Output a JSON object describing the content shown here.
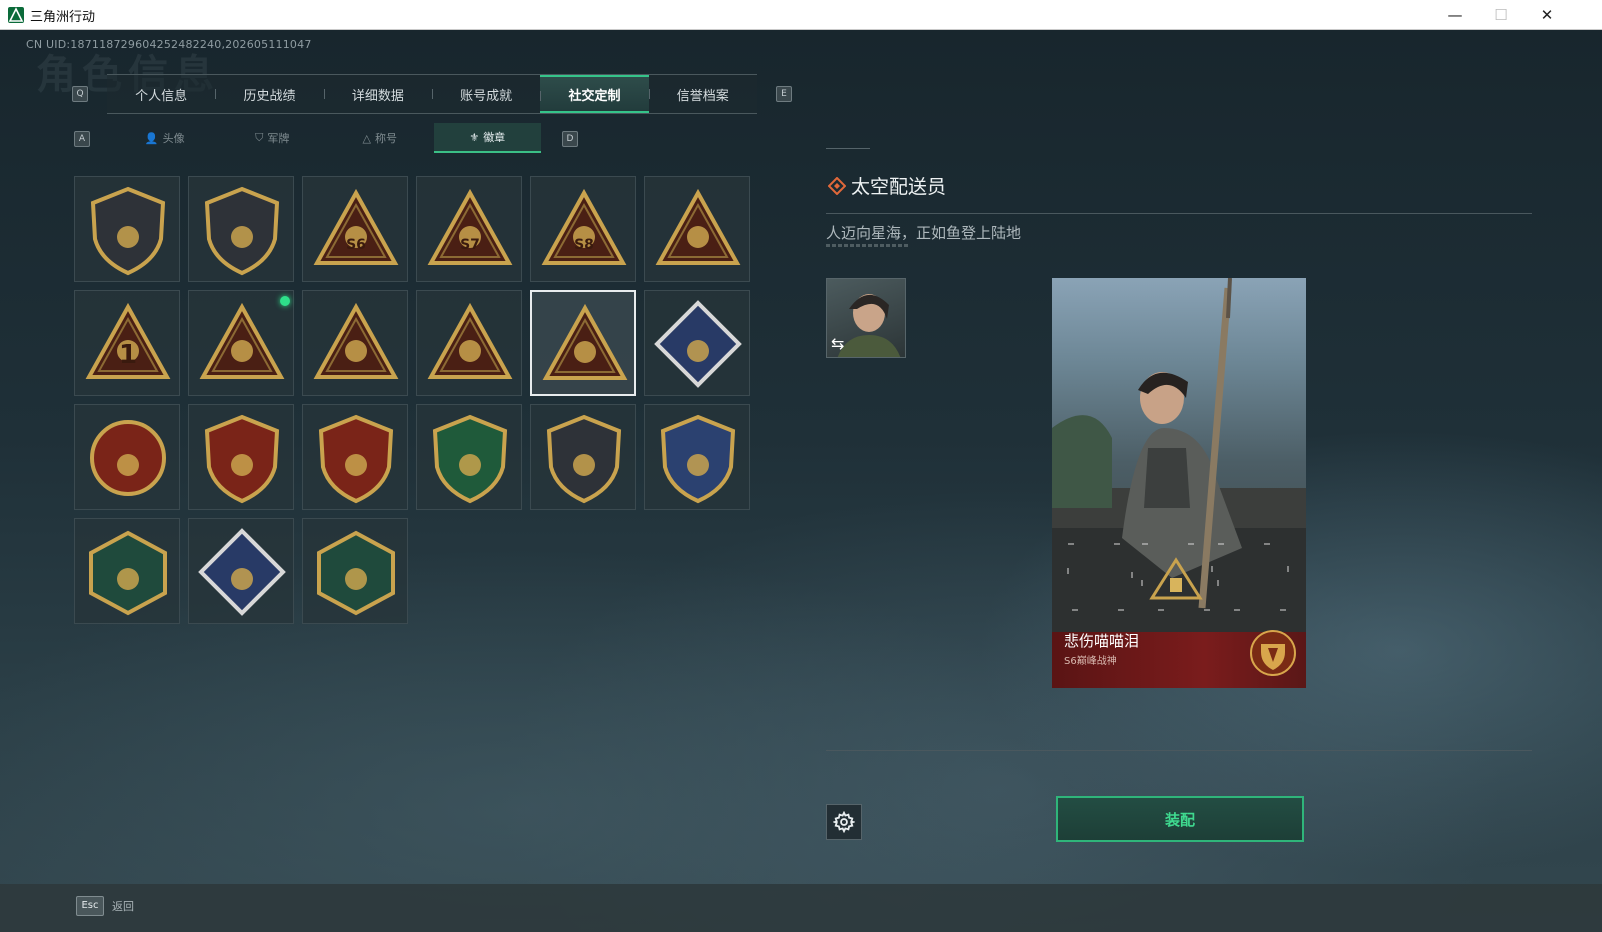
{
  "window": {
    "title": "三角洲行动",
    "minimize": "—",
    "maximize": "☐",
    "close": "✕"
  },
  "uid_text": "CN UID:187118729604252482240,202605111047",
  "background_title": "角色信息",
  "tab_keys": {
    "prev": "Q",
    "next": "E"
  },
  "tabs": [
    {
      "label": "个人信息"
    },
    {
      "label": "历史战绩"
    },
    {
      "label": "详细数据"
    },
    {
      "label": "账号成就"
    },
    {
      "label": "社交定制",
      "active": true
    },
    {
      "label": "信誉档案"
    }
  ],
  "subtab_keys": {
    "prev": "A",
    "next": "D"
  },
  "subtabs": [
    {
      "label": "头像",
      "icon": "person-icon"
    },
    {
      "label": "军牌",
      "icon": "dogtag-icon"
    },
    {
      "label": "称号",
      "icon": "title-icon"
    },
    {
      "label": "徽章",
      "icon": "badge-icon",
      "active": true
    }
  ],
  "badges": [
    {
      "icon": "shield-triangle-badge"
    },
    {
      "icon": "helicopter-badge"
    },
    {
      "icon": "s6-badge",
      "text": "S6"
    },
    {
      "icon": "s7-badge",
      "text": "S7"
    },
    {
      "icon": "s8-badge",
      "text": "S8"
    },
    {
      "icon": "nest-badge"
    },
    {
      "icon": "number-one-badge",
      "text": "1"
    },
    {
      "icon": "cargo-badge",
      "new": true
    },
    {
      "icon": "hands-gem-badge"
    },
    {
      "icon": "soldiers-badge"
    },
    {
      "icon": "rocket-badge",
      "selected": true
    },
    {
      "icon": "rose-diamond-badge"
    },
    {
      "icon": "star-roundel-badge"
    },
    {
      "icon": "stars-shield-badge"
    },
    {
      "icon": "stars-gem-badge"
    },
    {
      "icon": "green-rifle-badge"
    },
    {
      "icon": "dark-rifle-badge"
    },
    {
      "icon": "blue-crossed-badge"
    },
    {
      "icon": "bee-hex-badge"
    },
    {
      "icon": "dragon-diamond-badge"
    },
    {
      "icon": "dragonfly-hex-badge"
    }
  ],
  "detail": {
    "title": "太空配送员",
    "description": "人迈向星海，正如鱼登上陆地"
  },
  "card": {
    "player_name": "悲伤喵喵泪",
    "rank": "S6巅峰战神"
  },
  "actions": {
    "settings": "gear-icon",
    "equip_label": "装配"
  },
  "footer": {
    "esc_key": "Esc",
    "esc_label": "返回"
  },
  "colors": {
    "accent": "#35c48a",
    "gold": "#c9a34e",
    "card_band": "#7a1c1c"
  }
}
